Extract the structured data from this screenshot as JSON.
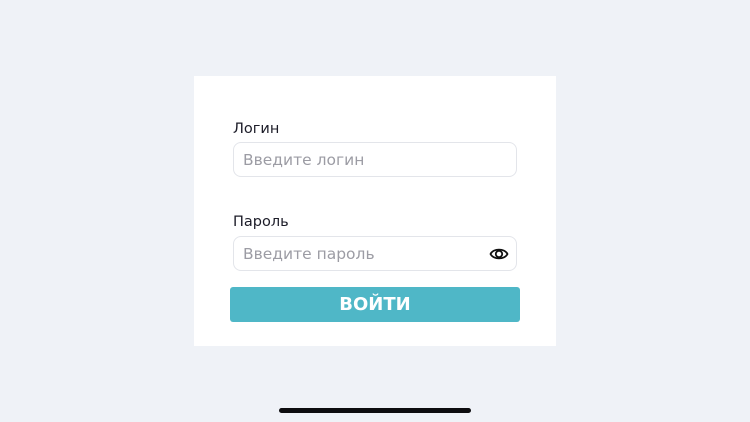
{
  "login_form": {
    "login": {
      "label": "Логин",
      "placeholder": "Введите логин",
      "value": ""
    },
    "password": {
      "label": "Пароль",
      "placeholder": "Введите пароль",
      "value": "",
      "toggle_icon": "eye-icon"
    },
    "submit_label": "ВОЙТИ"
  },
  "colors": {
    "background": "#eff2f7",
    "card": "#ffffff",
    "accent": "#4fb7c7",
    "label_text": "#1c1c28",
    "placeholder_text": "#9c9ca4"
  }
}
